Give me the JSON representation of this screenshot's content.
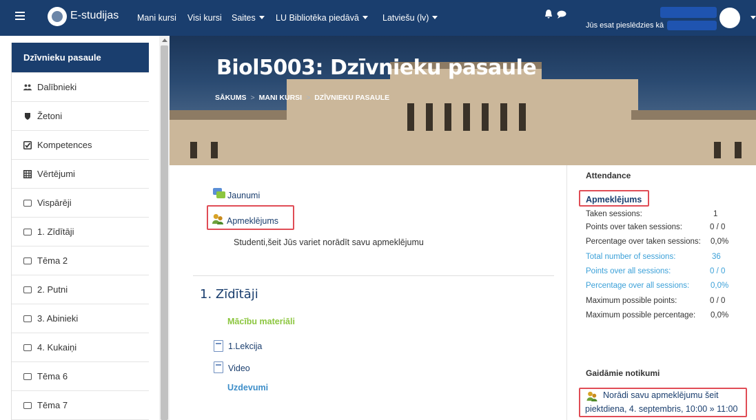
{
  "topnav": {
    "site_name": "E-studijas",
    "items": [
      {
        "label": "Mani kursi"
      },
      {
        "label": "Visi kursi"
      },
      {
        "label": "Saites"
      },
      {
        "label": "LU Bibliotēka piedāvā"
      },
      {
        "label": "Latviešu (lv)"
      }
    ],
    "logged_in_text": "Jūs esat pieslēdzies kā"
  },
  "sidebar": {
    "items": [
      {
        "label": "Dzīvnieku pasaule"
      },
      {
        "label": "Dalībnieki"
      },
      {
        "label": "Žetoni"
      },
      {
        "label": "Kompetences"
      },
      {
        "label": "Vērtējumi"
      },
      {
        "label": "Vispārēji"
      },
      {
        "label": "1. Zīdītāji"
      },
      {
        "label": "Tēma 2"
      },
      {
        "label": "2. Putni"
      },
      {
        "label": "3. Abinieki"
      },
      {
        "label": "4. Kukaiņi"
      },
      {
        "label": "Tēma 6"
      },
      {
        "label": "Tēma 7"
      }
    ]
  },
  "hero": {
    "title": "Biol5003: Dzīvnieku pasaule",
    "breadcrumb": [
      "SĀKUMS",
      "MANI KURSI",
      "DZĪVNIEKU PASAULE"
    ]
  },
  "main": {
    "activities": [
      {
        "label": "Jaunumi"
      },
      {
        "label": "Apmeklējums"
      }
    ],
    "description": "Studenti,šeit Jūs variet norādīt savu apmeklējumu",
    "section_title": "1. Zīdītāji",
    "section_label": "Mācību materiāli",
    "resources": [
      {
        "label": "1.Lekcija"
      },
      {
        "label": "Video"
      }
    ],
    "tasks_label": "Uzdevumi"
  },
  "attendance": {
    "block_title": "Attendance",
    "link": "Apmeklējums",
    "rows": [
      {
        "label": "Taken sessions:",
        "value": "1"
      },
      {
        "label": "Points over taken sessions:",
        "value": "0 / 0"
      },
      {
        "label": "Percentage over taken sessions:",
        "value": "0,0%"
      },
      {
        "label": "Total number of sessions:",
        "value": "36"
      },
      {
        "label": "Points over all sessions:",
        "value": "0 / 0"
      },
      {
        "label": "Percentage over all sessions:",
        "value": "0,0%"
      },
      {
        "label": "Maximum possible points:",
        "value": "0 / 0"
      },
      {
        "label": "Maximum possible percentage:",
        "value": "0,0%"
      }
    ]
  },
  "events": {
    "block_title": "Gaidāmie notikumi",
    "event_link": "Norādi savu apmeklējumu šeit",
    "event_date": "piektdiena, 4. septembris, 10:00 » 11:00"
  },
  "colors": {
    "nav_bg": "#1a3e6e",
    "highlight": "#e04c55",
    "green": "#8cc63f",
    "light_blue": "#3ba0d8"
  }
}
